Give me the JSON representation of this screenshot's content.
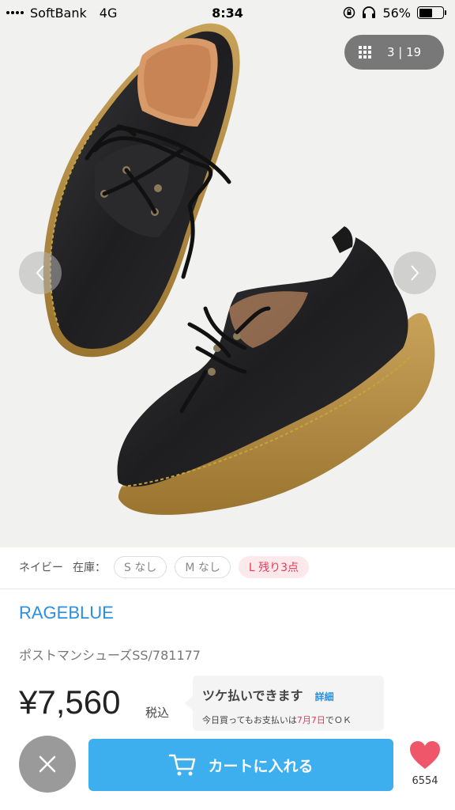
{
  "status_bar": {
    "carrier": "SoftBank",
    "network": "4G",
    "time": "8:34",
    "battery": "56%",
    "battery_level": 0.56
  },
  "gallery": {
    "counter": "3 | 19",
    "current_index": 3,
    "total_images": 19
  },
  "stock": {
    "color_label": "ネイビー",
    "stock_label": "在庫：",
    "sizes": [
      {
        "label": "S なし"
      },
      {
        "label": "M なし"
      },
      {
        "label": "L 残り3点"
      }
    ]
  },
  "product": {
    "brand": "RAGEBLUE",
    "name": "ポストマンシューズSS/781177",
    "price": "¥7,560",
    "tax_label": "税込"
  },
  "tsuke": {
    "title": "ツケ払いできます",
    "link": "詳細",
    "desc_prefix": "今日買ってもお支払いは",
    "desc_date": "7月7日",
    "desc_suffix": "でＯＫ"
  },
  "actions": {
    "cart_label": "カートに入れる",
    "like_count": "6554"
  },
  "colors": {
    "accent_blue": "#3daeee",
    "brand_blue": "#2a8fe0",
    "alert_red": "#e53a57",
    "heart": "#f0566a"
  }
}
